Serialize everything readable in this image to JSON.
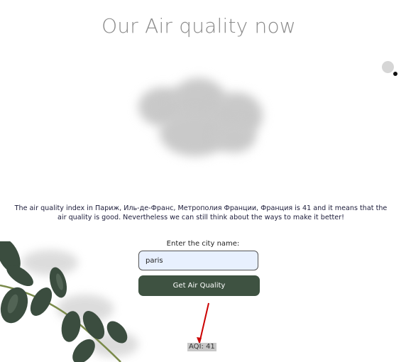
{
  "page": {
    "title": "Our Air quality now"
  },
  "result": {
    "description": "The air quality index in Париж, Иль-де-Франс, Метрополия Франции, Франция is 41 and it means that the air quality is good. Nevertheless we can still think about the ways to make it better!"
  },
  "form": {
    "label": "Enter the city name:",
    "city_value": "paris",
    "button_label": "Get Air Quality"
  },
  "aqi": {
    "text": "AQI: 41"
  },
  "icons": {
    "decor_dots": "dots-icon",
    "cloud": "cloud-image",
    "plant": "eucalyptus-image",
    "arrow": "arrow-annotation"
  },
  "colors": {
    "button_bg": "#3e5241",
    "input_bg": "#e8f0fe",
    "title": "#8a8a8a",
    "arrow": "#cc0000"
  }
}
